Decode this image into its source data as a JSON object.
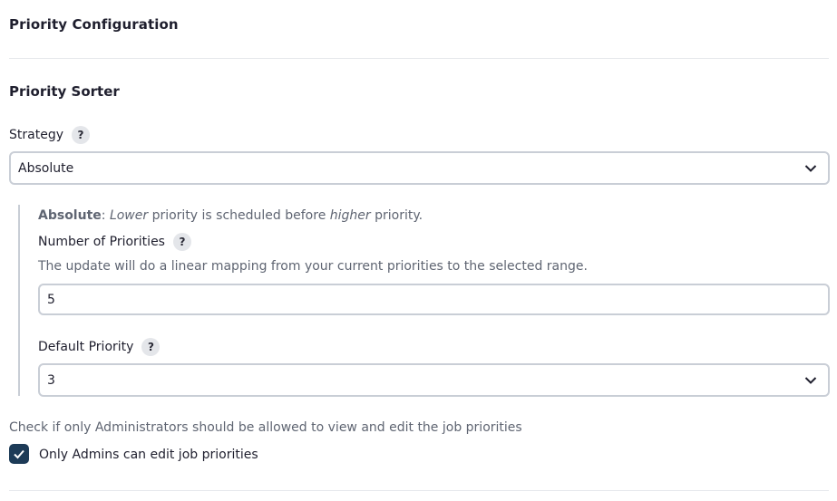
{
  "header": {
    "title": "Priority Configuration"
  },
  "section": {
    "title": "Priority Sorter"
  },
  "strategy": {
    "label": "Strategy",
    "help": "?",
    "selected": "Absolute",
    "description": {
      "name": "Absolute",
      "sep": ": ",
      "word1": "Lower",
      "mid": " priority is scheduled before ",
      "word2": "higher",
      "end": " priority."
    }
  },
  "number_of_priorities": {
    "label": "Number of Priorities",
    "help": "?",
    "hint": "The update will do a linear mapping from your current priorities to the selected range.",
    "value": "5"
  },
  "default_priority": {
    "label": "Default Priority",
    "help": "?",
    "selected": "3"
  },
  "admins_only": {
    "hint": "Check if only Administrators should be allowed to view and edit the job priorities",
    "label": "Only Admins can edit job priorities",
    "checked": true
  },
  "colors": {
    "accent": "#1d3b57",
    "border": "#c9ced6",
    "muted_text": "#5f6572"
  }
}
